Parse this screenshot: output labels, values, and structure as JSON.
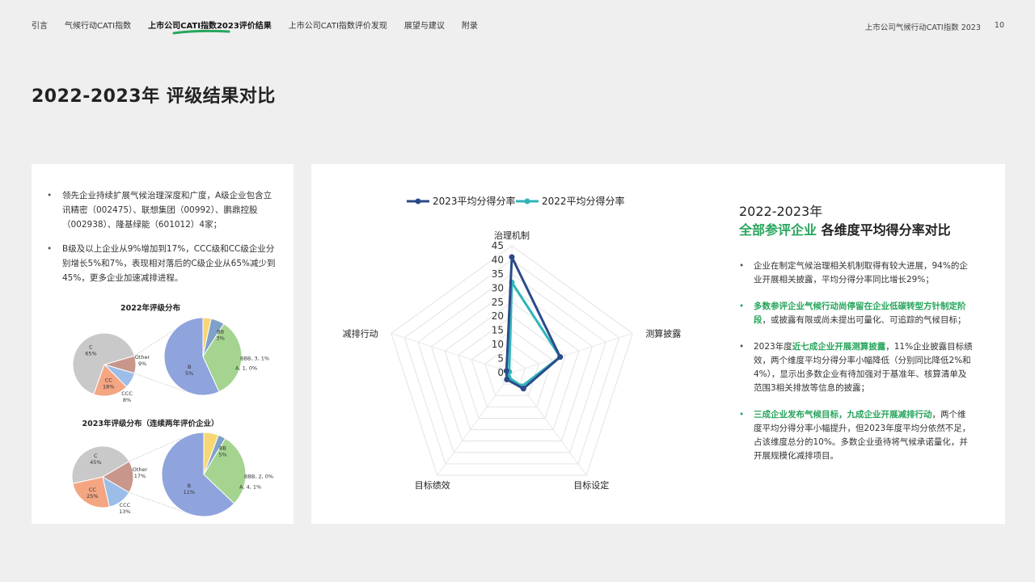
{
  "nav": {
    "items": [
      "引言",
      "气候行动CATI指数",
      "上市公司CATI指数2023评价结果",
      "上市公司CATI指数评价发现",
      "展望与建议",
      "附录"
    ],
    "active_index": 2
  },
  "header": {
    "report_name": "上市公司气候行动CATI指数 2023",
    "page_number": "10"
  },
  "page_title": "2022-2023年 评级结果对比",
  "left": {
    "bullets": [
      "领先企业持续扩展气候治理深度和广度，A级企业包含立讯精密（002475）、联想集团（00992）、鹏鼎控股（002938）、隆基绿能（601012）4家；",
      "B级及以上企业从9%增加到17%，CCC级和CC级企业分别增长5%和7%，表现相对落后的C级企业从65%减少到45%，更多企业加速减排进程。"
    ]
  },
  "right": {
    "heading_line1": "2022-2023年",
    "heading_line2_highlight": "全部参评企业",
    "heading_line2_rest": " 各维度平均得分率对比",
    "bullets": [
      {
        "green": false,
        "pre": "",
        "hl": "",
        "post": "企业在制定气候治理相关机制取得有较大进展，94%的企业开展相关披露，平均分得分率同比增长29%；"
      },
      {
        "green": true,
        "pre": "",
        "hl": "多数参评企业气候行动尚停留在企业低碳转型方针制定阶段",
        "post": "，或披露有限或尚未提出可量化、可追踪的气候目标；"
      },
      {
        "green": false,
        "pre": "2023年度",
        "hl": "近七成企业开展测算披露",
        "post": "，11%企业披露目标绩效，两个维度平均分得分率小幅降低（分别同比降低2%和4%），显示出多数企业有待加强对于基准年、核算清单及范围3相关排放等信息的披露；"
      },
      {
        "green": true,
        "pre": "",
        "hl": "三成企业发布气候目标，九成企业开展减排行动",
        "post": "，两个维度平均分得分率小幅提升，但2023年度平均分依然不足，占该维度总分的10%。多数企业亟待将气候承诺量化，并开展规模化减排项目。"
      }
    ]
  },
  "chart_data": [
    {
      "type": "radar",
      "title": "",
      "axes": [
        "治理机制",
        "测算披露",
        "目标设定",
        "目标绩效",
        "减排行动"
      ],
      "rlim": [
        0,
        45
      ],
      "ticks": [
        "0",
        "5",
        "10",
        "15",
        "20",
        "25",
        "30",
        "35",
        "40",
        "45"
      ],
      "legend_position": "top",
      "series": [
        {
          "name": "2023平均分得分率",
          "color": "#2c4a8a",
          "values": [
            41,
            18,
            7,
            3,
            2
          ]
        },
        {
          "name": "2022平均分得分率",
          "color": "#2eb5b9",
          "values": [
            32,
            18,
            6,
            2,
            1
          ]
        }
      ]
    },
    {
      "type": "pie",
      "title": "2022年评级分布",
      "slices": [
        {
          "label": "C",
          "value_label": "65%",
          "value": 65,
          "color": "#c9c9c9"
        },
        {
          "label": "Other",
          "value_label": "9%",
          "value": 9,
          "color": "#c8968a"
        },
        {
          "label": "CCC",
          "value_label": "8%",
          "value": 8,
          "color": "#9cbde8"
        },
        {
          "label": "CC",
          "value_label": "18%",
          "value": 18,
          "color": "#f4a582"
        }
      ],
      "breakdown": [
        {
          "label": "B",
          "value_label": "5%",
          "value": 5,
          "color": "#8fa3dc"
        },
        {
          "label": "BB",
          "value_label": "3%",
          "value": 3,
          "color": "#a4d490"
        },
        {
          "label": "BBB",
          "value_label": "3, 1%",
          "value": 0.5,
          "color": "#7fa1c9"
        },
        {
          "label": "A",
          "value_label": "1, 0%",
          "value": 0.3,
          "color": "#f7d774"
        }
      ]
    },
    {
      "type": "pie",
      "title": "2023年评级分布（连续两年评价企业）",
      "slices": [
        {
          "label": "C",
          "value_label": "45%",
          "value": 45,
          "color": "#c9c9c9"
        },
        {
          "label": "Other",
          "value_label": "17%",
          "value": 17,
          "color": "#c8968a"
        },
        {
          "label": "CCC",
          "value_label": "13%",
          "value": 13,
          "color": "#9cbde8"
        },
        {
          "label": "CC",
          "value_label": "25%",
          "value": 25,
          "color": "#f4a582"
        }
      ],
      "breakdown": [
        {
          "label": "B",
          "value_label": "11%",
          "value": 11,
          "color": "#8fa3dc"
        },
        {
          "label": "BB",
          "value_label": "5%",
          "value": 5,
          "color": "#a4d490"
        },
        {
          "label": "BBB",
          "value_label": "2, 0%",
          "value": 0.5,
          "color": "#7fa1c9"
        },
        {
          "label": "A",
          "value_label": "4, 1%",
          "value": 1,
          "color": "#f7d774"
        }
      ]
    }
  ]
}
